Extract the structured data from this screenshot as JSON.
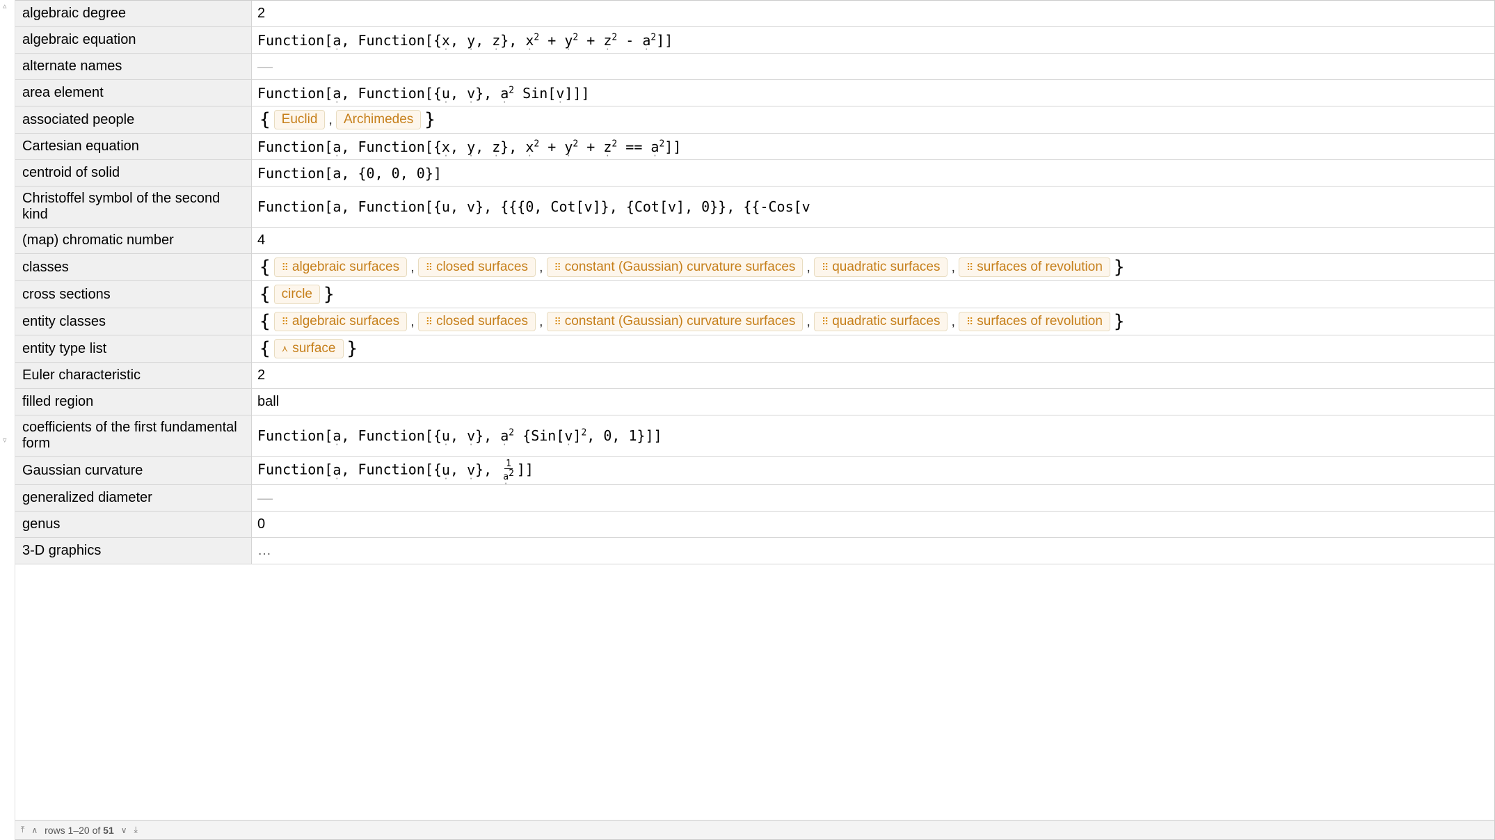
{
  "footer": {
    "rows_prefix": "rows 1–20 of ",
    "total": "51"
  },
  "rows": [
    {
      "key": "algebraic degree",
      "type": "plain",
      "value": "2"
    },
    {
      "key": "algebraic equation",
      "type": "code_xyz_minus"
    },
    {
      "key": "alternate names",
      "type": "dash"
    },
    {
      "key": "area element",
      "type": "code_area"
    },
    {
      "key": "associated people",
      "type": "entities_plain",
      "items": [
        "Euclid",
        "Archimedes"
      ]
    },
    {
      "key": "Cartesian equation",
      "type": "code_xyz_eq"
    },
    {
      "key": "centroid of solid",
      "type": "code_plain",
      "value": "Function[a, {0, 0, 0}]"
    },
    {
      "key": "Christoffel symbol of the second kind",
      "type": "code_plain",
      "value": "Function[a, Function[{u, v}, {{{0, Cot[v]}, {Cot[v], 0}}, {{-Cos[v"
    },
    {
      "key": "(map) chromatic number",
      "type": "plain",
      "value": "4"
    },
    {
      "key": "classes",
      "type": "entities_dots",
      "items": [
        "algebraic surfaces",
        "closed surfaces",
        "constant (Gaussian) curvature surfaces",
        "quadratic surfaces",
        "surfaces of revolution"
      ]
    },
    {
      "key": "cross sections",
      "type": "entities_plain",
      "items": [
        "circle"
      ]
    },
    {
      "key": "entity classes",
      "type": "entities_dots",
      "items": [
        "algebraic surfaces",
        "closed surfaces",
        "constant (Gaussian) curvature surfaces",
        "quadratic surfaces",
        "surfaces of revolution"
      ]
    },
    {
      "key": "entity type list",
      "type": "entities_tri",
      "items": [
        "surface"
      ]
    },
    {
      "key": "Euler characteristic",
      "type": "plain",
      "value": "2"
    },
    {
      "key": "filled region",
      "type": "plain",
      "value": "ball"
    },
    {
      "key": "coefficients of the first fundamental form",
      "type": "code_fff"
    },
    {
      "key": "Gaussian curvature",
      "type": "code_gauss"
    },
    {
      "key": "generalized diameter",
      "type": "dash"
    },
    {
      "key": "genus",
      "type": "plain",
      "value": "0"
    },
    {
      "key": "3-D graphics",
      "type": "ellipsis"
    }
  ]
}
